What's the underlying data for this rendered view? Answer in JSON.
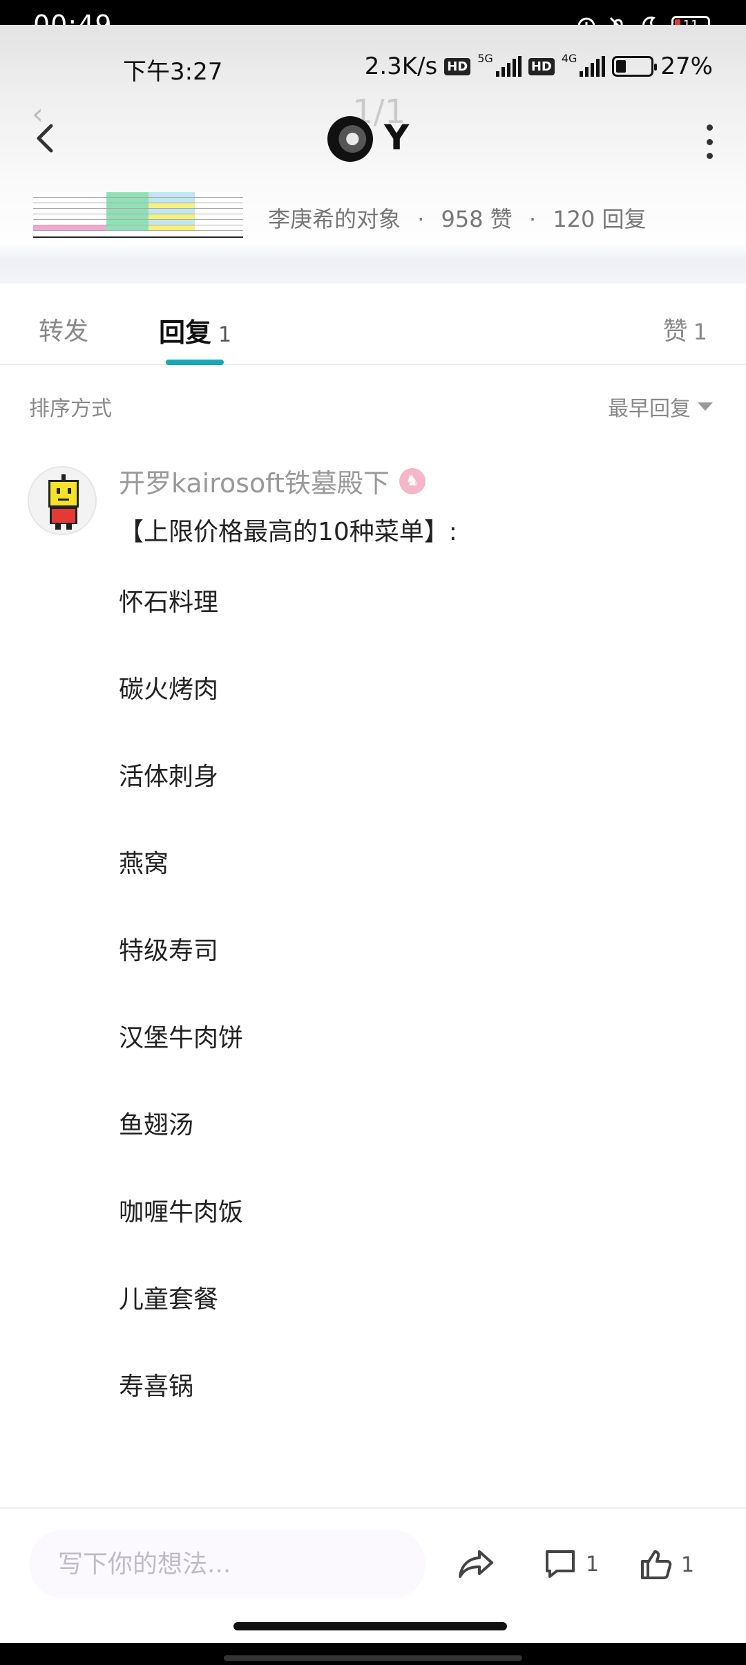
{
  "outer_status": {
    "time": "00:49",
    "battery": "11"
  },
  "status_bar": {
    "time": "下午3:27",
    "net_speed": "2.3K/s",
    "hd1": "HD",
    "net1": "5G",
    "hd2": "HD",
    "net2": "4G",
    "battery_percent": "27%"
  },
  "nav": {
    "ghost_page": "1/1",
    "author_name": "Y"
  },
  "post_summary": {
    "source": "李庚希的对象",
    "sep1": "·",
    "likes": "958 赞",
    "sep2": "·",
    "replies": "120 回复"
  },
  "tabs": {
    "repost": "转发",
    "reply": "回复",
    "reply_count": "1",
    "like": "赞",
    "like_count": "1"
  },
  "sort": {
    "label": "排序方式",
    "value": "最早回复"
  },
  "comment": {
    "author": "开罗kairosoft铁墓殿下",
    "heading": "【上限价格最高的10种菜单】:",
    "dishes": [
      "怀石料理",
      "碳火烤肉",
      "活体刺身",
      "燕窝",
      "特级寿司",
      "汉堡牛肉饼",
      "鱼翅汤",
      "咖喱牛肉饭",
      "儿童套餐",
      "寿喜锅"
    ]
  },
  "bottom_bar": {
    "input_placeholder": "写下你的想法...",
    "comment_count": "1",
    "like_count": "1"
  },
  "colors": {
    "accent": "#1ba7b8",
    "badge": "#f4b6c8"
  }
}
